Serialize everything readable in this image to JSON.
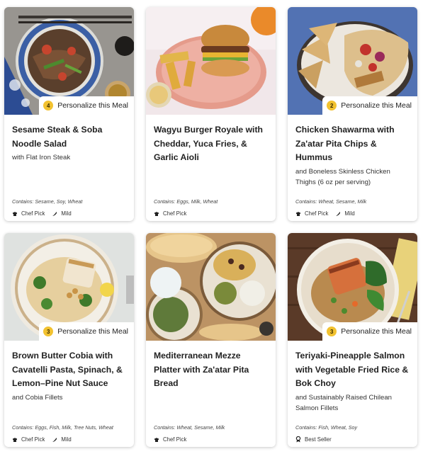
{
  "cards": [
    {
      "title": "Sesame Steak & Soba Noodle Salad",
      "subtitle": "with Flat Iron Steak",
      "personalize": {
        "count": "4",
        "label": "Personalize this Meal"
      },
      "contains": "Contains: Sesame, Soy, Wheat",
      "tags": [
        {
          "icon": "chef-hat-icon",
          "label": "Chef Pick"
        },
        {
          "icon": "chili-icon",
          "label": "Mild"
        }
      ]
    },
    {
      "title": "Wagyu Burger Royale with Cheddar, Yuca Fries, & Garlic Aioli",
      "subtitle": "",
      "personalize": null,
      "contains": "Contains: Eggs, Milk, Wheat",
      "tags": [
        {
          "icon": "chef-hat-icon",
          "label": "Chef Pick"
        }
      ]
    },
    {
      "title": "Chicken Shawarma with Za'atar Pita Chips & Hummus",
      "subtitle": "and Boneless Skinless Chicken Thighs (6 oz per serving)",
      "personalize": {
        "count": "2",
        "label": "Personalize this Meal"
      },
      "contains": "Contains: Wheat, Sesame, Milk",
      "tags": [
        {
          "icon": "chef-hat-icon",
          "label": "Chef Pick"
        },
        {
          "icon": "chili-icon",
          "label": "Mild"
        }
      ]
    },
    {
      "title": "Brown Butter Cobia with Cavatelli Pasta, Spinach, & Lemon–Pine Nut Sauce",
      "subtitle": "and Cobia Fillets",
      "personalize": {
        "count": "3",
        "label": "Personalize this Meal"
      },
      "contains": "Contains: Eggs, Fish, Milk, Tree Nuts, Wheat",
      "tags": [
        {
          "icon": "chef-hat-icon",
          "label": "Chef Pick"
        },
        {
          "icon": "chili-icon",
          "label": "Mild"
        }
      ]
    },
    {
      "title": "Mediterranean Mezze Platter with Za'atar Pita Bread",
      "subtitle": "",
      "personalize": null,
      "contains": "Contains: Wheat, Sesame, Milk",
      "tags": [
        {
          "icon": "chef-hat-icon",
          "label": "Chef Pick"
        }
      ]
    },
    {
      "title": "Teriyaki-Pineapple Salmon with Vegetable Fried Rice & Bok Choy",
      "subtitle": "and Sustainably Raised Chilean Salmon Fillets",
      "personalize": {
        "count": "3",
        "label": "Personalize this Meal"
      },
      "contains": "Contains: Fish, Wheat, Soy",
      "tags": [
        {
          "icon": "ribbon-icon",
          "label": "Best Seller"
        }
      ]
    }
  ]
}
